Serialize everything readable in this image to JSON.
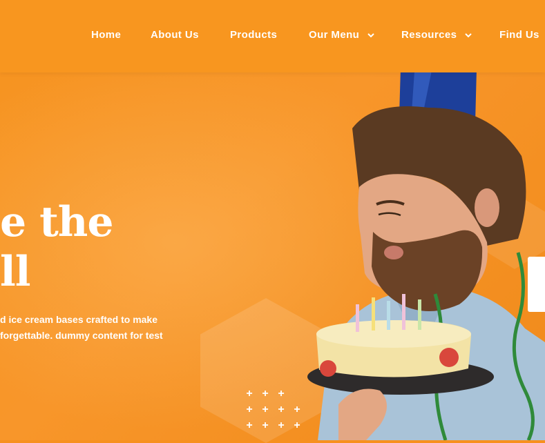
{
  "nav": {
    "items": [
      {
        "label": "Home",
        "has_dropdown": false
      },
      {
        "label": "About Us",
        "has_dropdown": false
      },
      {
        "label": "Products",
        "has_dropdown": false
      },
      {
        "label": "Our Menu",
        "has_dropdown": true
      },
      {
        "label": "Resources",
        "has_dropdown": true
      },
      {
        "label": "Find Us",
        "has_dropdown": false
      }
    ]
  },
  "hero": {
    "headline_line1": "e the",
    "headline_line2": "ll",
    "description_line1": "d ice cream bases crafted to make",
    "description_line2": "forgettable. dummy content for test"
  },
  "colors": {
    "brand": "#f7901e",
    "text": "#ffffff"
  },
  "icons": {
    "dropdown": "chevron-down-icon",
    "decoration": "plus-icon"
  }
}
